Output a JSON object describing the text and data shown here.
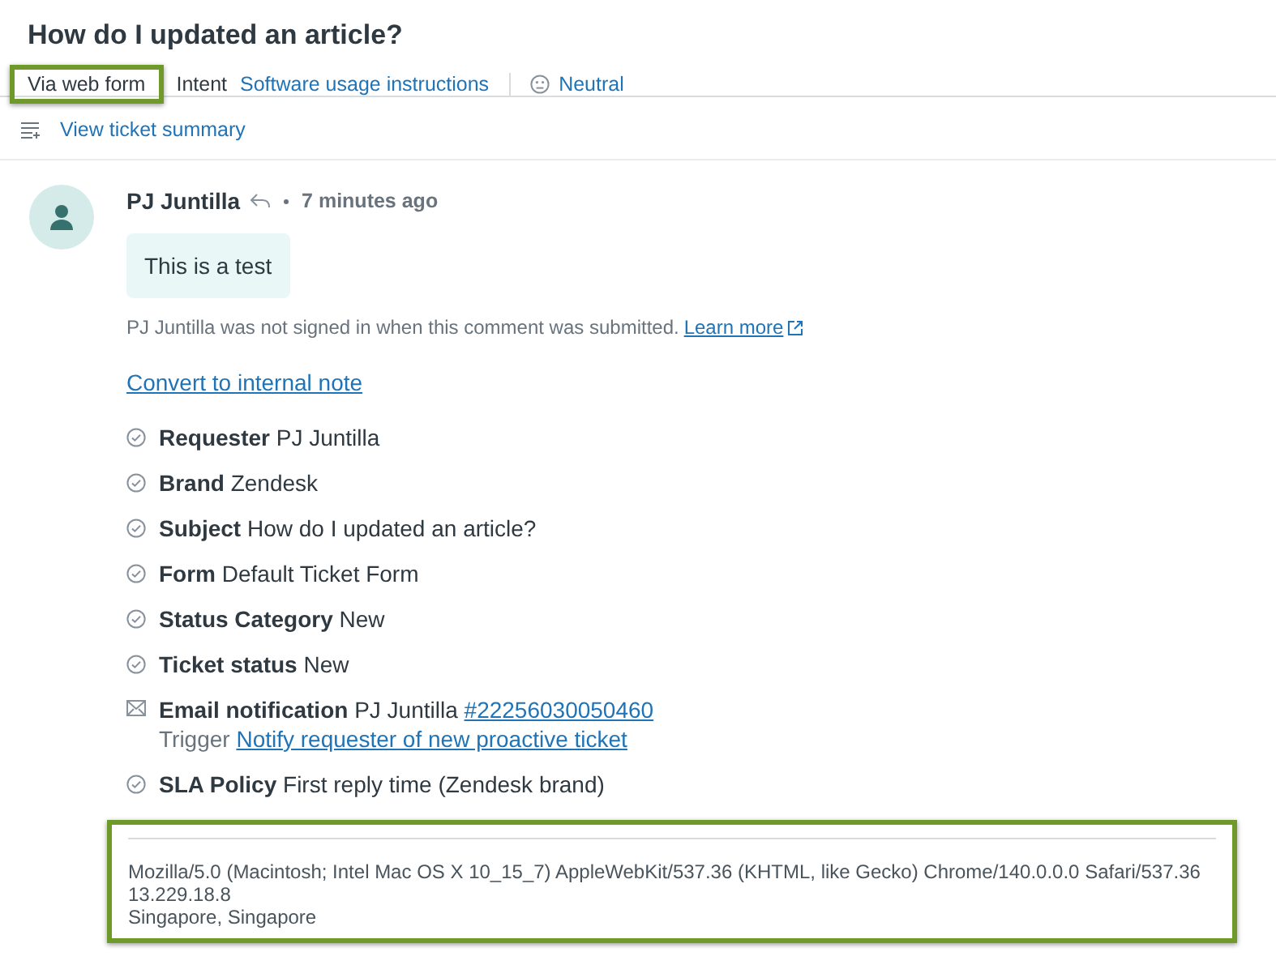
{
  "title": "How do I updated an article?",
  "meta": {
    "channel": "Via web form",
    "channel_highlighted": true,
    "intent_label": "Intent",
    "intent": "Software usage instructions",
    "sentiment": "Neutral"
  },
  "summary_link": "View ticket summary",
  "comment": {
    "author": "PJ Juntilla",
    "time": "7 minutes ago",
    "body": "This is a test",
    "notice": "PJ Juntilla was not signed in when this comment was submitted.",
    "learn_more": "Learn more",
    "convert_link": "Convert to internal note"
  },
  "events": [
    {
      "kind": "check",
      "label": "Requester",
      "value": "PJ Juntilla"
    },
    {
      "kind": "check",
      "label": "Brand",
      "value": "Zendesk"
    },
    {
      "kind": "check",
      "label": "Subject",
      "value": "How do I updated an article?"
    },
    {
      "kind": "check",
      "label": "Form",
      "value": "Default Ticket Form"
    },
    {
      "kind": "check",
      "label": "Status Category",
      "value": "New"
    },
    {
      "kind": "check",
      "label": "Ticket status",
      "value": "New"
    },
    {
      "kind": "email",
      "label": "Email notification",
      "value": "PJ Juntilla",
      "link": "#22256030050460",
      "trigger_label": "Trigger",
      "trigger": "Notify requester of new proactive ticket"
    },
    {
      "kind": "check",
      "label": "SLA Policy",
      "value": "First reply time (Zendesk brand)"
    }
  ],
  "client_info": {
    "highlighted": true,
    "lines": [
      "Mozilla/5.0 (Macintosh; Intel Mac OS X 10_15_7) AppleWebKit/537.36 (KHTML, like Gecko) Chrome/140.0.0.0 Safari/537.36",
      "13.229.18.8",
      "Singapore, Singapore"
    ]
  }
}
